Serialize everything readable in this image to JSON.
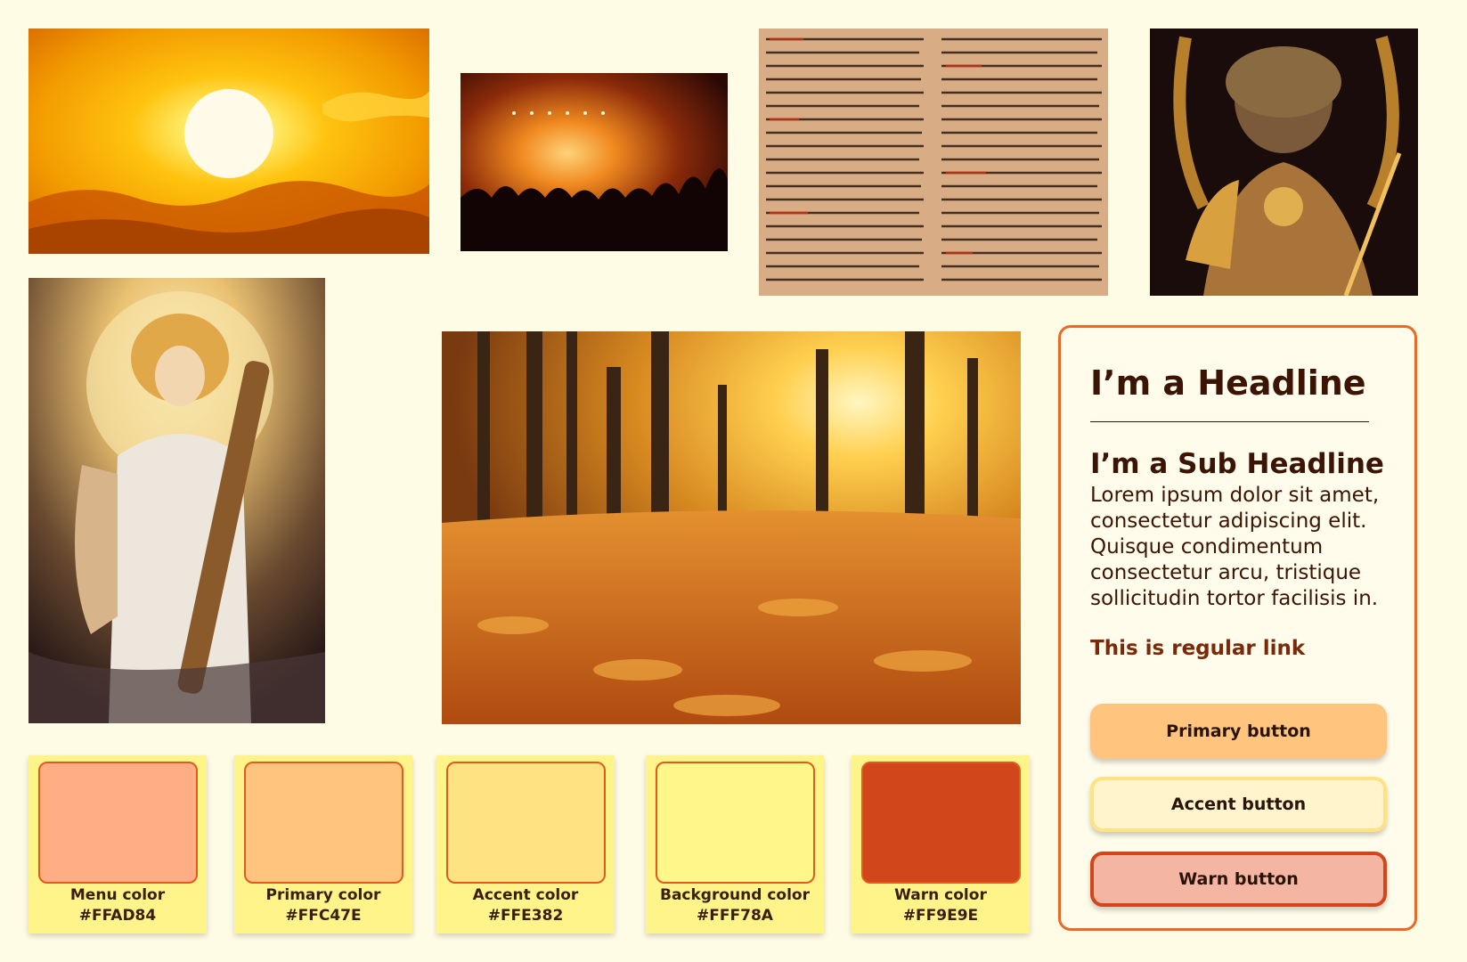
{
  "images": {
    "sun": "sunset-sky-photo",
    "concert": "concert-crowd-photo",
    "papyrus": "egyptian-papyrus-photo",
    "statue": "golden-god-statue-art",
    "apollo": "apollo-lyre-illustration",
    "forest": "autumn-forest-photo"
  },
  "swatches": [
    {
      "name": "Menu color",
      "hex": "#FFAD84",
      "color": "#FFAD84"
    },
    {
      "name": "Primary color",
      "hex": "#FFC47E",
      "color": "#FFC47E"
    },
    {
      "name": "Accent color",
      "hex": "#FFE382",
      "color": "#FFE382"
    },
    {
      "name": "Background color",
      "hex": "#FFF78A",
      "color": "#FFF78A"
    },
    {
      "name": "Warn color",
      "hex": "#FF9E9E",
      "color": "#D2461B"
    }
  ],
  "panel": {
    "headline": "I’m a Headline",
    "subheadline": "I’m a Sub Headline",
    "body": "Lorem ipsum dolor sit amet, consectetur adipiscing elit. Quisque condimentum consectetur arcu, tristique sollicitudin tortor facilisis in.",
    "link": "This is regular link",
    "primary_button": "Primary button",
    "accent_button": "Accent button",
    "warn_button": "Warn button"
  }
}
